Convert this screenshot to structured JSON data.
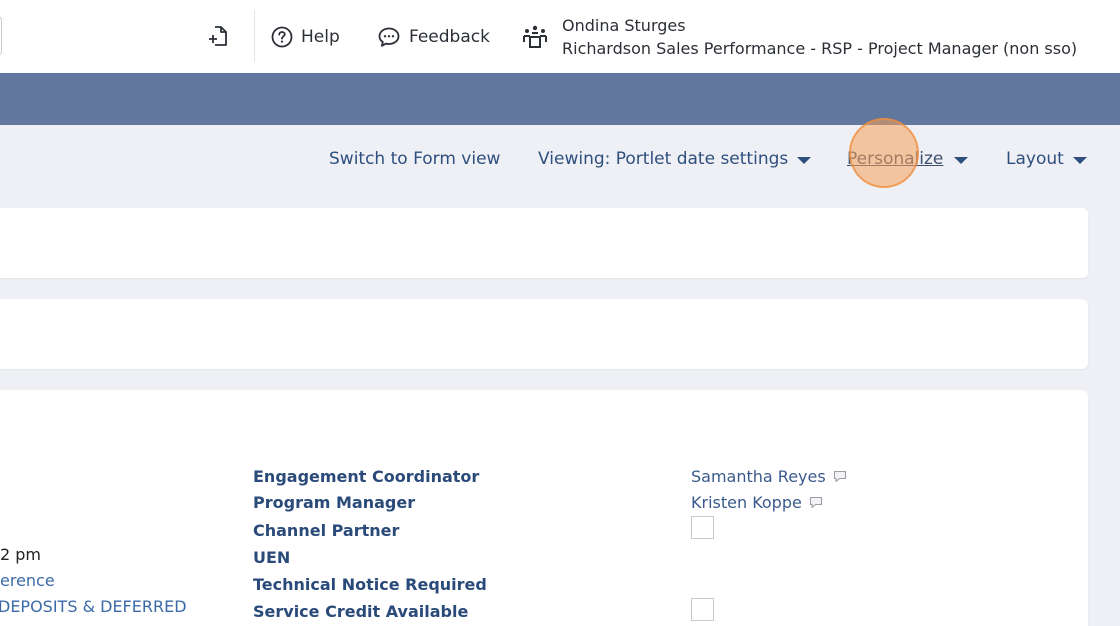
{
  "header": {
    "help_label": "Help",
    "feedback_label": "Feedback",
    "user_name": "Ondina Sturges",
    "user_org": "Richardson Sales Performance - RSP - Project Manager (non sso)"
  },
  "toolbar": {
    "switch_label": "Switch to Form view",
    "viewing_label": "Viewing: Portlet date settings",
    "personalize_label": "Personalize",
    "layout_label": "Layout"
  },
  "left_fragments": {
    "time": "2 pm",
    "reference": "erence",
    "deposits": "DEPOSITS & DEFERRED"
  },
  "fields": [
    {
      "label": "Engagement Coordinator",
      "value": "Samantha Reyes",
      "type": "text"
    },
    {
      "label": "Program Manager",
      "value": "Kristen Koppe",
      "type": "text"
    },
    {
      "label": "Channel Partner",
      "value": "",
      "type": "checkbox"
    },
    {
      "label": "UEN",
      "value": "",
      "type": "empty"
    },
    {
      "label": "Technical Notice Required",
      "value": "",
      "type": "empty"
    },
    {
      "label": "Service Credit Available",
      "value": "",
      "type": "checkbox"
    }
  ],
  "colors": {
    "band": "#62779d",
    "link": "#2f4f7e",
    "label": "#2a4a7a",
    "click_highlight": "#f6a05a"
  },
  "icons": {
    "new_record": "new-record-icon",
    "help": "help-circle-icon",
    "feedback": "feedback-bubble-icon",
    "user": "user-group-icon",
    "comment": "comment-icon"
  }
}
